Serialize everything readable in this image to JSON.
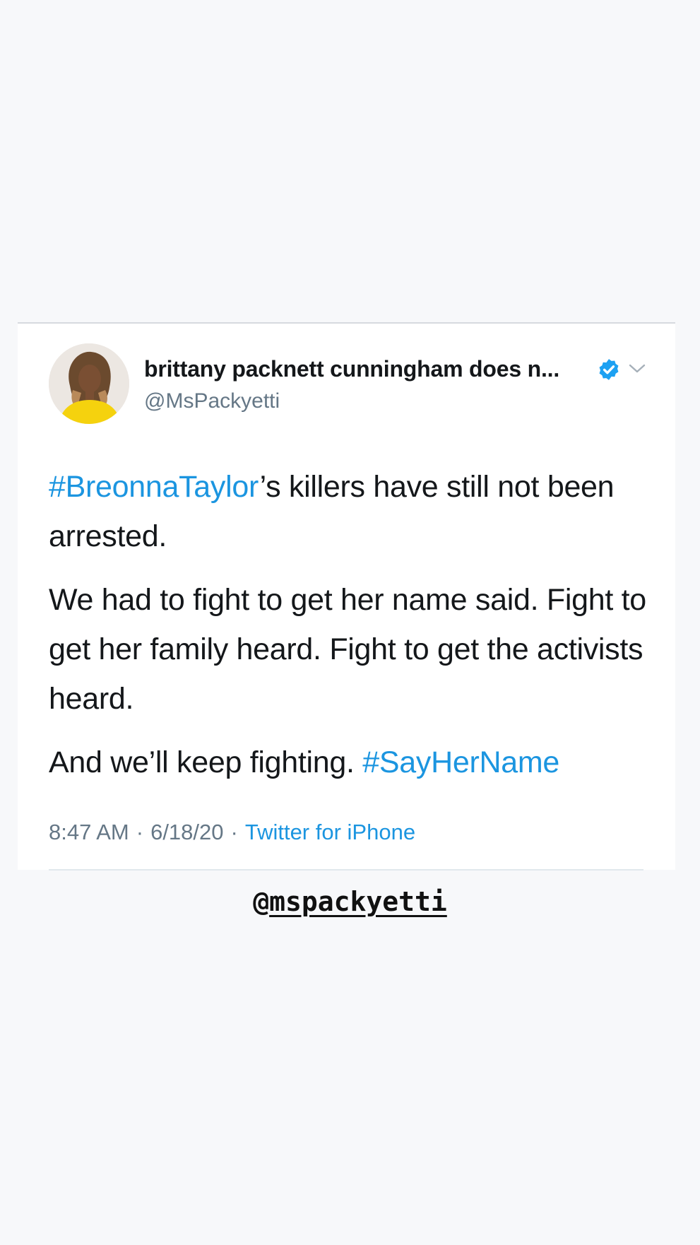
{
  "tweet": {
    "display_name": "brittany packnett cunningham does n...",
    "handle": "@MsPackyetti",
    "verified_icon": "verified-badge-icon",
    "menu_icon": "chevron-down-icon",
    "body": {
      "p1_hashtag": "#BreonnaTaylor",
      "p1_text": "’s killers have still not been arrested.",
      "p2_text": "We had to fight to get her name said. Fight to get her family heard. Fight to get the activists heard.",
      "p3_text": "And we’ll keep fighting. ",
      "p3_hashtag": "#SayHerName"
    },
    "time": "8:47 AM",
    "sep1": "·",
    "date": "6/18/20",
    "sep2": "·",
    "source": "Twitter for iPhone"
  },
  "mention": {
    "at": "@",
    "user": "mspackyetti"
  },
  "colors": {
    "background": "#f7f8fa",
    "link": "#1b95e0",
    "verified": "#1da1f2",
    "text": "#14171a",
    "secondary": "#657786"
  }
}
